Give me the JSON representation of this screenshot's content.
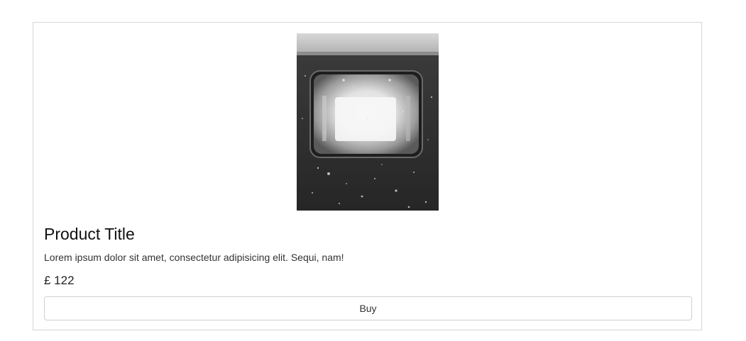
{
  "product": {
    "image_alt": "Product Image",
    "image_subject": "train-window-photo",
    "title": "Product Title",
    "description": "Lorem ipsum dolor sit amet, consectetur adipisicing elit. Sequi, nam!",
    "price": "£ 122",
    "buy_label": "Buy"
  }
}
